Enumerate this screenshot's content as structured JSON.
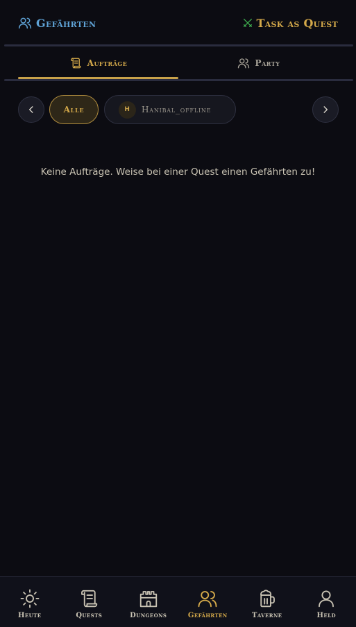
{
  "header": {
    "title": "Gefährten",
    "title_icon": "users-icon",
    "app_name": "Task as Quest",
    "app_icon": "crossed-swords-icon"
  },
  "tabs": [
    {
      "label": "Aufträge",
      "icon": "scroll-icon",
      "active": true
    },
    {
      "label": "Party",
      "icon": "users-icon",
      "active": false
    }
  ],
  "filters": {
    "all_label": "Alle",
    "user": {
      "avatar_initial": "H",
      "name": "Hanibal_offline"
    }
  },
  "empty_message": "Keine Aufträge. Weise bei einer Quest einen Gefährten zu!",
  "bottom_nav": [
    {
      "label": "Heute",
      "icon": "sun-icon"
    },
    {
      "label": "Quests",
      "icon": "scroll-icon"
    },
    {
      "label": "Dungeons",
      "icon": "castle-icon"
    },
    {
      "label": "Gefährten",
      "icon": "users-icon",
      "active": true
    },
    {
      "label": "Taverne",
      "icon": "beer-mug-icon"
    },
    {
      "label": "Held",
      "icon": "user-icon"
    }
  ],
  "colors": {
    "background": "#0c0c12",
    "accent_gold": "#d4a94a",
    "accent_blue": "#5fa3d6"
  }
}
